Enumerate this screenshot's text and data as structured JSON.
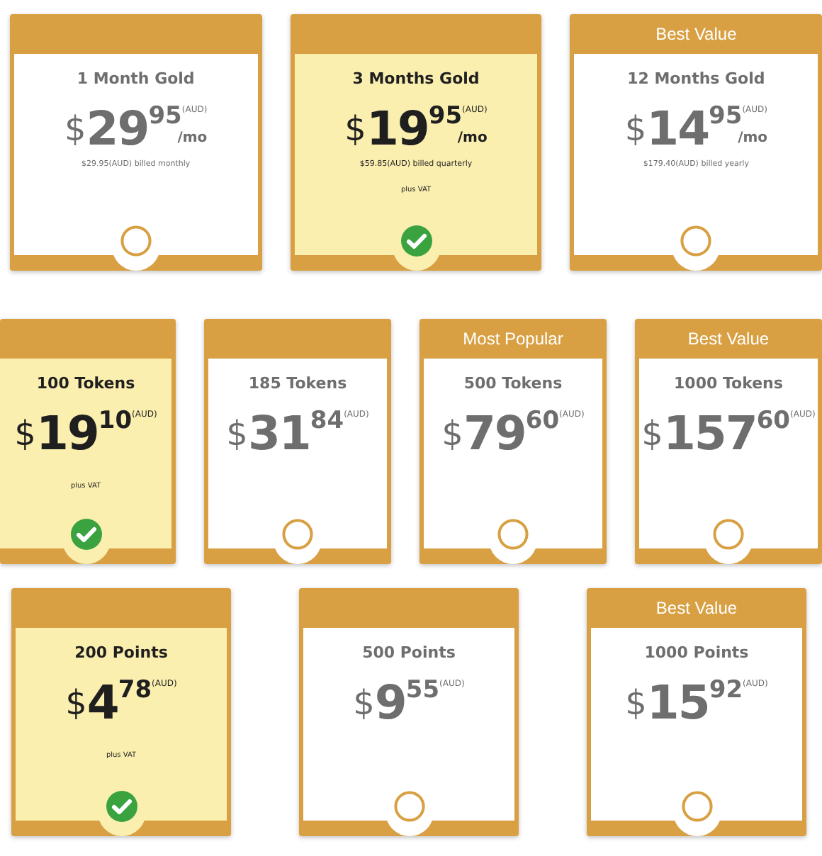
{
  "sections": [
    {
      "plans": [
        {
          "name": "1 Month Gold",
          "currency": "$",
          "whole": "29",
          "cents": "95",
          "unit": "(AUD)",
          "per": "/mo",
          "note": "$29.95(AUD) billed monthly",
          "selected": false
        },
        {
          "name": "3 Months Gold",
          "currency": "$",
          "whole": "19",
          "cents": "95",
          "unit": "(AUD)",
          "per": "/mo",
          "note": "$59.85(AUD) billed quarterly",
          "vat": "plus VAT",
          "selected": true
        },
        {
          "ribbon": "Best Value",
          "name": "12 Months Gold",
          "currency": "$",
          "whole": "14",
          "cents": "95",
          "unit": "(AUD)",
          "per": "/mo",
          "note": "$179.40(AUD) billed yearly",
          "selected": false
        }
      ]
    },
    {
      "plans": [
        {
          "name": "100 Tokens",
          "currency": "$",
          "whole": "19",
          "cents": "10",
          "unit": "(AUD)",
          "vat": "plus VAT",
          "selected": true
        },
        {
          "name": "185 Tokens",
          "currency": "$",
          "whole": "31",
          "cents": "84",
          "unit": "(AUD)",
          "selected": false
        },
        {
          "ribbon": "Most Popular",
          "name": "500 Tokens",
          "currency": "$",
          "whole": "79",
          "cents": "60",
          "unit": "(AUD)",
          "selected": false
        },
        {
          "ribbon": "Best Value",
          "name": "1000 Tokens",
          "currency": "$",
          "whole": "157",
          "cents": "60",
          "unit": "(AUD)",
          "selected": false
        }
      ]
    },
    {
      "plans": [
        {
          "name": "200 Points",
          "currency": "$",
          "whole": "4",
          "cents": "78",
          "unit": "(AUD)",
          "vat": "plus VAT",
          "selected": true
        },
        {
          "name": "500 Points",
          "currency": "$",
          "whole": "9",
          "cents": "55",
          "unit": "(AUD)",
          "selected": false
        },
        {
          "ribbon": "Best Value",
          "name": "1000 Points",
          "currency": "$",
          "whole": "15",
          "cents": "92",
          "unit": "(AUD)",
          "selected": false
        }
      ]
    }
  ]
}
